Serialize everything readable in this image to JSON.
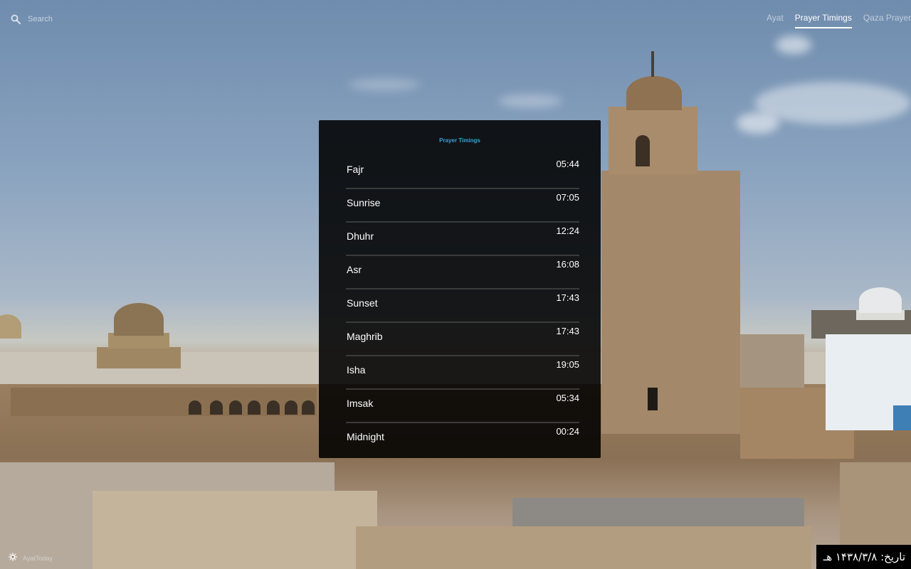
{
  "search": {
    "placeholder": "Search"
  },
  "nav": {
    "items": [
      {
        "label": "Ayat",
        "active": false
      },
      {
        "label": "Prayer Timings",
        "active": true
      },
      {
        "label": "Qaza Prayers",
        "active": false
      }
    ]
  },
  "panel": {
    "title": "Prayer Timings",
    "prayers": [
      {
        "name": "Fajr",
        "time": "05:44"
      },
      {
        "name": "Sunrise",
        "time": "07:05"
      },
      {
        "name": "Dhuhr",
        "time": "12:24"
      },
      {
        "name": "Asr",
        "time": "16:08"
      },
      {
        "name": "Sunset",
        "time": "17:43"
      },
      {
        "name": "Maghrib",
        "time": "17:43"
      },
      {
        "name": "Isha",
        "time": "19:05"
      },
      {
        "name": "Imsak",
        "time": "05:34"
      },
      {
        "name": "Midnight",
        "time": "00:24"
      }
    ]
  },
  "footer": {
    "brand": "AyatToday",
    "hijri_date": "تاریخ: ۱۴۳۸/۳/۸ هـ"
  },
  "colors": {
    "accent": "#3aa0d8",
    "panel_bg": "#000000",
    "text": "#ffffff"
  },
  "icons": {
    "search": "search-icon",
    "settings": "gear-icon"
  }
}
